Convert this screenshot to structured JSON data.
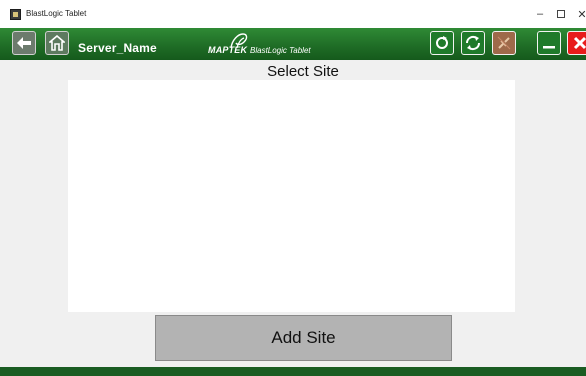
{
  "window": {
    "title": "BlastLogic Tablet",
    "minimize_glyph": "–",
    "close_glyph": "✕"
  },
  "toolbar": {
    "server_name": "Server_Name",
    "logo_brand": "MAPTEK",
    "logo_product": "BlastLogic Tablet",
    "icons": {
      "back": "back-arrow-icon",
      "home": "home-icon",
      "refresh": "refresh-icon",
      "sync": "sync-icon",
      "disconnect": "disconnect-icon",
      "minimize": "minimize-icon",
      "exit": "close-icon"
    }
  },
  "main": {
    "heading": "Select Site",
    "add_site_label": "Add Site"
  },
  "colors": {
    "toolbar_green": "#1e6b25",
    "exit_red": "#e81b1b",
    "disconnect_brown": "#9e6a4a",
    "button_gray": "#b3b3b3"
  }
}
